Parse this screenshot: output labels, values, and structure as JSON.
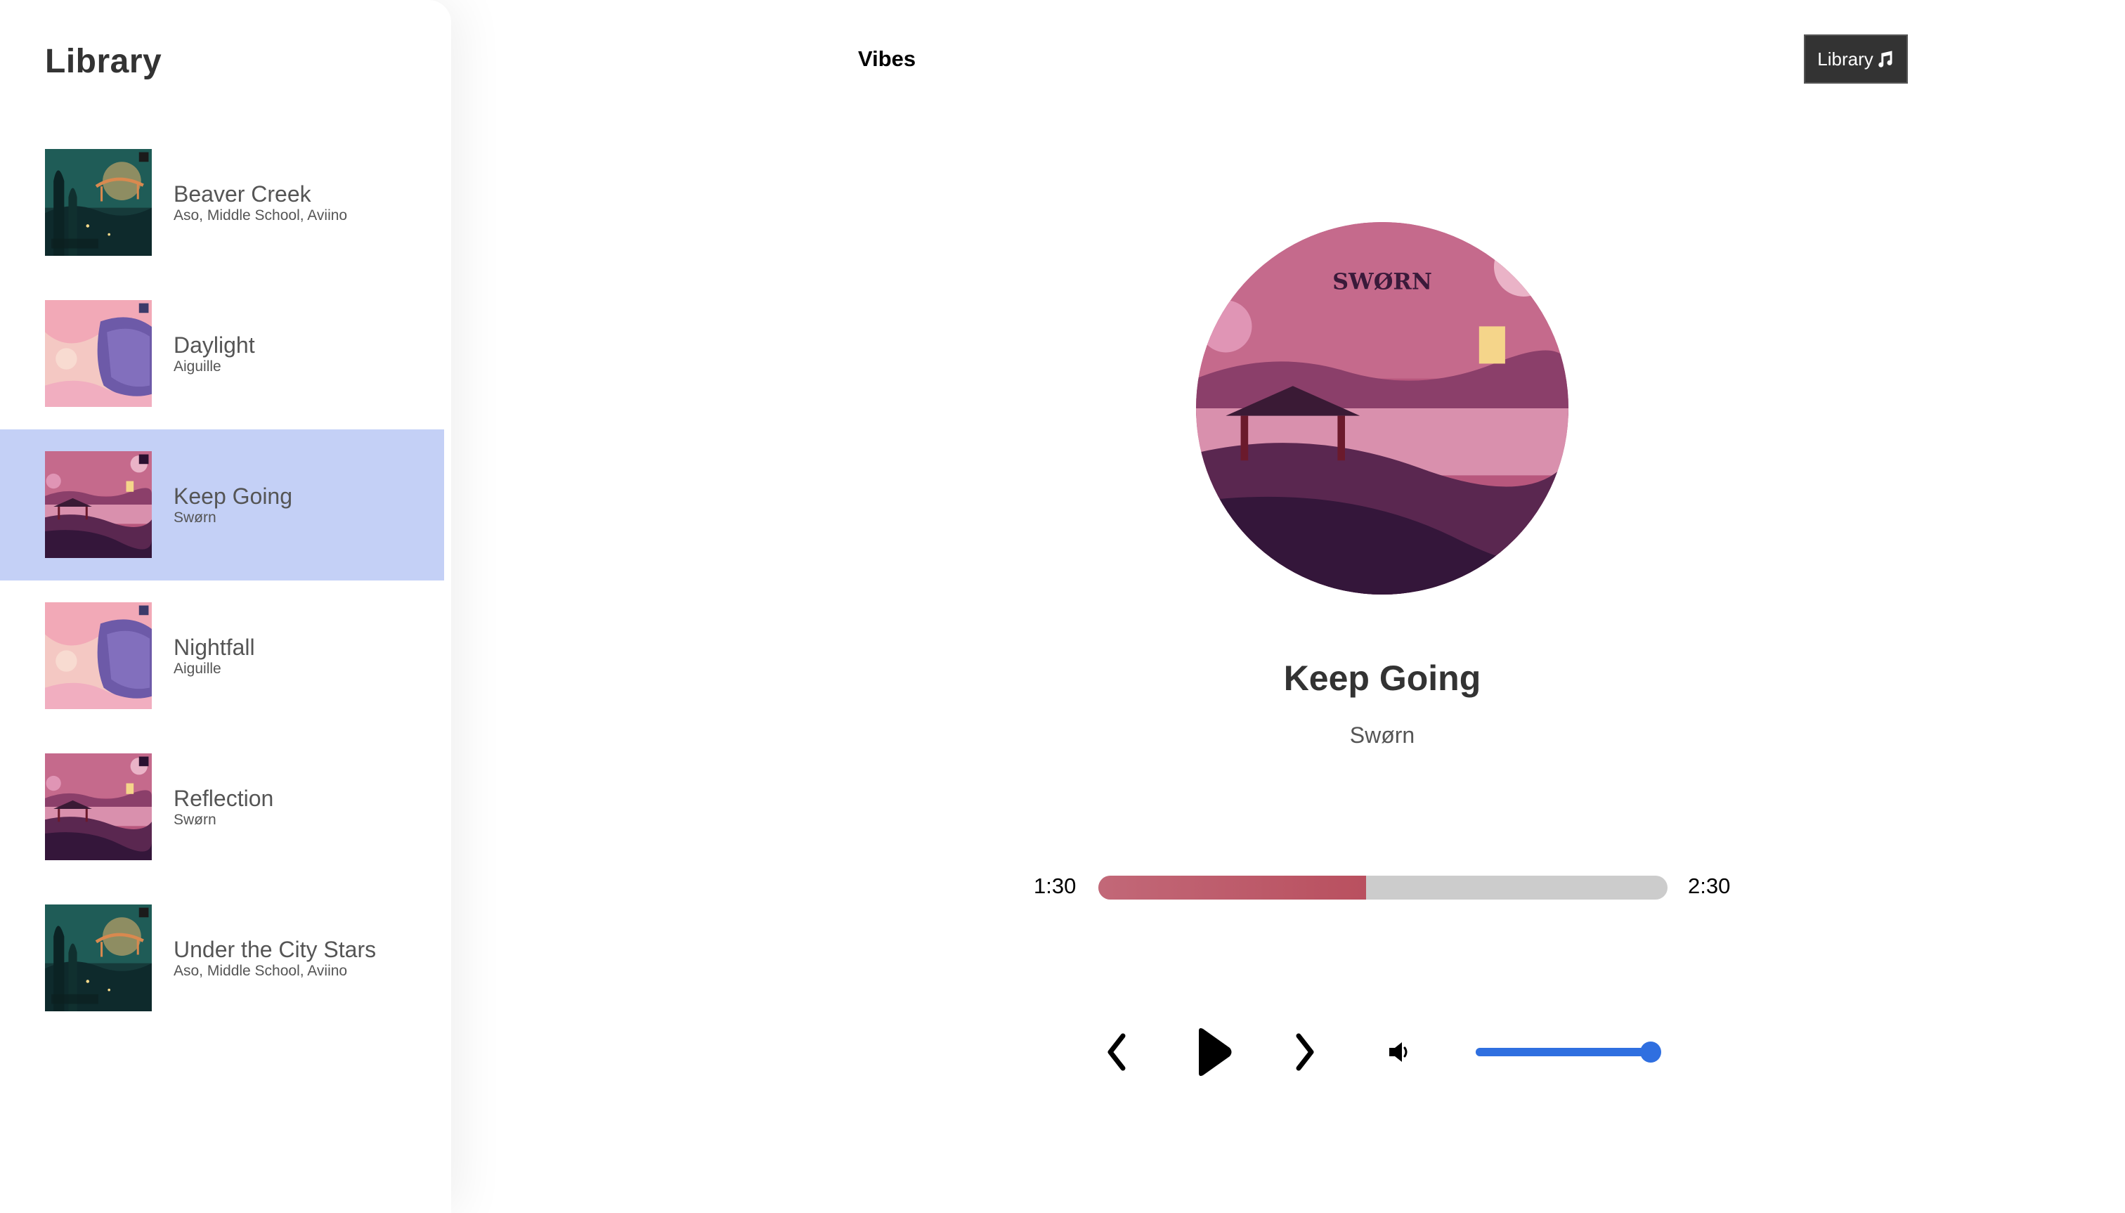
{
  "library": {
    "title": "Library",
    "songs": [
      {
        "name": "Beaver Creek",
        "artist": "Aso, Middle School, Aviino",
        "cover": "forest-cover",
        "selected": false
      },
      {
        "name": "Daylight",
        "artist": "Aiguille",
        "cover": "pink-sky-cover",
        "selected": false
      },
      {
        "name": "Keep Going",
        "artist": "Swørn",
        "cover": "purple-lake-cover",
        "selected": true
      },
      {
        "name": "Nightfall",
        "artist": "Aiguille",
        "cover": "pink-sky-cover",
        "selected": false
      },
      {
        "name": "Reflection",
        "artist": "Swørn",
        "cover": "purple-lake-cover",
        "selected": false
      },
      {
        "name": "Under the City Stars",
        "artist": "Aso, Middle School, Aviino",
        "cover": "forest-cover",
        "selected": false
      }
    ]
  },
  "nav": {
    "brand": "Vibes",
    "library_button": "Library",
    "library_button_icon": "music-note-icon"
  },
  "now_playing": {
    "title": "Keep Going",
    "artist": "Swørn",
    "artwork": "purple-lake-cover",
    "artwork_text": "SWØRN"
  },
  "progress": {
    "current_time": "1:30",
    "total_time": "2:30",
    "fraction": 0.47
  },
  "controls": {
    "prev_icon": "chevron-left-icon",
    "play_icon": "play-icon",
    "next_icon": "chevron-right-icon",
    "volume_icon": "speaker-icon",
    "volume_level": 0.95
  },
  "colors": {
    "selected_row": "#c4d0f6",
    "progress_fill": "#c26878",
    "progress_track": "#cccccc",
    "volume_accent": "#2f6fe0",
    "toggle_bg": "#333333"
  }
}
